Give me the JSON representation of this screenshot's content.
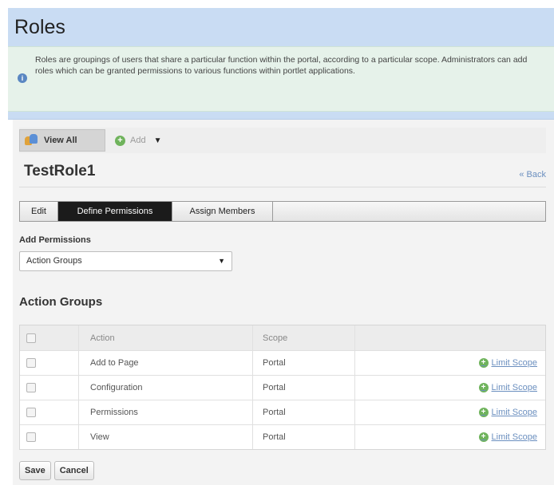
{
  "header": {
    "title": "Roles",
    "info_text": "Roles are groupings of users that share a particular function within the portal, according to a particular scope. Administrators can add roles which can be granted permissions to various functions within portlet applications."
  },
  "toolbar": {
    "view_all_label": "View All",
    "add_label": "Add",
    "add_arrow": "▼"
  },
  "role": {
    "name": "TestRole1",
    "back_label": "« Back"
  },
  "tabs": [
    {
      "label": "Edit"
    },
    {
      "label": "Define Permissions",
      "active": true
    },
    {
      "label": "Assign Members"
    }
  ],
  "permissions": {
    "add_label": "Add Permissions",
    "select_value": "Action Groups",
    "section_title": "Action Groups",
    "columns": {
      "action": "Action",
      "scope": "Scope"
    },
    "rows": [
      {
        "action": "Add to Page",
        "scope": "Portal",
        "limit": "Limit Scope"
      },
      {
        "action": "Configuration",
        "scope": "Portal",
        "limit": "Limit Scope"
      },
      {
        "action": "Permissions",
        "scope": "Portal",
        "limit": "Limit Scope"
      },
      {
        "action": "View",
        "scope": "Portal",
        "limit": "Limit Scope"
      }
    ]
  },
  "buttons": {
    "save": "Save",
    "cancel": "Cancel"
  },
  "colors": {
    "header_bg": "#c9dcf3",
    "info_bg": "#e6f2ea",
    "active_tab": "#1b1b1b",
    "link": "#6b8fbf",
    "add_icon": "#6fb35c"
  }
}
